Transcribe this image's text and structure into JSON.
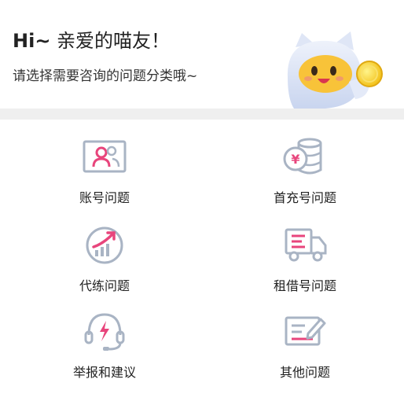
{
  "header": {
    "greeting_prefix": "Hi~",
    "greeting_text": "亲爱的喵友！",
    "subtitle": "请选择需要咨询的问题分类哦~"
  },
  "categories": [
    {
      "label": "账号问题",
      "icon": "account-card-icon"
    },
    {
      "label": "首充号问题",
      "icon": "coin-stack-icon"
    },
    {
      "label": "代练问题",
      "icon": "leveling-chart-icon"
    },
    {
      "label": "租借号问题",
      "icon": "delivery-truck-icon"
    },
    {
      "label": "举报和建议",
      "icon": "headset-icon"
    },
    {
      "label": "其他问题",
      "icon": "note-pencil-icon"
    }
  ],
  "colors": {
    "accent": "#e8457c",
    "icon_gray": "#a9b4c4",
    "divider": "#efefef"
  }
}
